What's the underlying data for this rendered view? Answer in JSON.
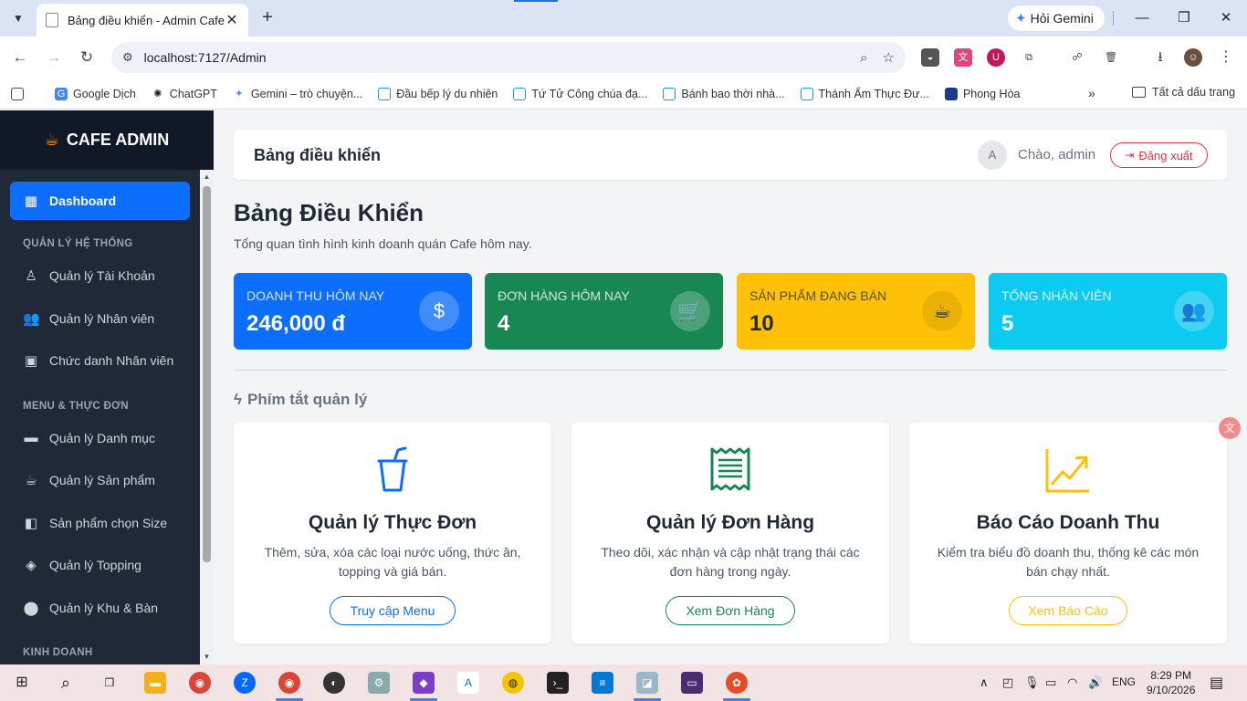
{
  "browser": {
    "tab_title": "Bảng điều khiển - Admin Cafe",
    "gemini_label": "Hỏi Gemini",
    "url": "localhost:7127/Admin",
    "bookmarks": [
      "Google Dịch",
      "ChatGPT",
      "Gemini – trò chuyện...",
      "Đầu bếp lý du nhiên",
      "Tứ Tử Công chúa đạ...",
      "Bánh bao thời nhà...",
      "Thánh Ẩm Thực Đư...",
      "Phong Hòa"
    ],
    "all_bookmarks": "Tất cả dấu trang"
  },
  "sidebar": {
    "brand": "CAFE ADMIN",
    "active_item": "Dashboard",
    "section_system": "QUẢN LÝ HỆ THỐNG",
    "accounts": "Quản lý Tài Khoản",
    "staff": "Quản lý Nhân viên",
    "titles": "Chức danh Nhân viên",
    "section_menu": "MENU & THỰC ĐƠN",
    "categories": "Quản lý Danh mục",
    "products": "Quản lý Sản phẩm",
    "sizes": "Sản phẩm chọn Size",
    "toppings": "Quản lý Topping",
    "areas": "Quản lý Khu & Bàn",
    "section_business": "KINH DOANH"
  },
  "header": {
    "title": "Bảng điều khiển",
    "avatar_initial": "A",
    "greeting": "Chào, admin",
    "logout": "Đăng xuất"
  },
  "page": {
    "title": "Bảng Điều Khiển",
    "subtitle": "Tổng quan tình hình kinh doanh quán Cafe hôm nay."
  },
  "stats": {
    "revenue": {
      "label": "DOANH THU HÔM NAY",
      "value": "246,000 đ",
      "color": "#0d6efd"
    },
    "orders": {
      "label": "ĐƠN HÀNG HÔM NAY",
      "value": "4",
      "color": "#198754"
    },
    "products": {
      "label": "SẢN PHẨM ĐANG BÁN",
      "value": "10",
      "color": "#ffc107"
    },
    "staff": {
      "label": "TỔNG NHÂN VIÊN",
      "value": "5",
      "color": "#0dcaf0"
    }
  },
  "shortcuts": {
    "title": "Phím tắt quản lý",
    "menu": {
      "title": "Quản lý Thực Đơn",
      "desc": "Thêm, sửa, xóa các loại nước uống, thức ăn, topping và giá bán.",
      "button": "Truy cập Menu",
      "color": "#0d6efd"
    },
    "orders": {
      "title": "Quản lý Đơn Hàng",
      "desc": "Theo dõi, xác nhận và cập nhật trạng thái các đơn hàng trong ngày.",
      "button": "Xem Đơn Hàng",
      "color": "#198754"
    },
    "reports": {
      "title": "Báo Cáo Doanh Thu",
      "desc": "Kiểm tra biểu đồ doanh thu, thống kê các món bán chạy nhất.",
      "button": "Xem Báo Cáo",
      "color": "#ffc107"
    }
  },
  "taskbar": {
    "language": "ENG",
    "time": "8:29 PM",
    "date": "9/10/2026"
  }
}
